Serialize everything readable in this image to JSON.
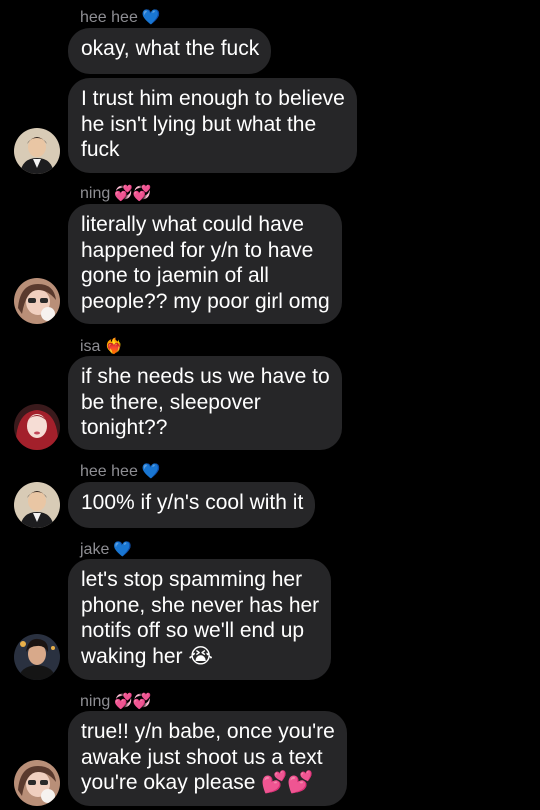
{
  "messages": [
    {
      "sender": "hee hee",
      "sender_emoji": "💙",
      "text": "okay, what the fuck"
    },
    {
      "text": "I trust him enough to believe\nhe isn't lying but what the\nfuck"
    },
    {
      "sender": "ning",
      "sender_emoji": "💞💞",
      "text": "literally what could have\nhappened for y/n to have\ngone to jaemin of all\npeople?? my poor girl omg"
    },
    {
      "sender": "isa",
      "sender_emoji": "❤️‍🔥",
      "text": "if she needs us we have to\nbe there, sleepover\ntonight??"
    },
    {
      "sender": "hee hee",
      "sender_emoji": "💙",
      "text": "100% if y/n's cool with it"
    },
    {
      "sender": "jake",
      "sender_emoji": "💙",
      "text": "let's stop spamming her\nphone, she never has her\nnotifs off so we'll end up\nwaking her 😭"
    },
    {
      "sender": "ning",
      "sender_emoji": "💞💞",
      "text": "true!! y/n babe, once you're\nawake just shoot us a text\nyou're okay please 💕💕"
    }
  ]
}
